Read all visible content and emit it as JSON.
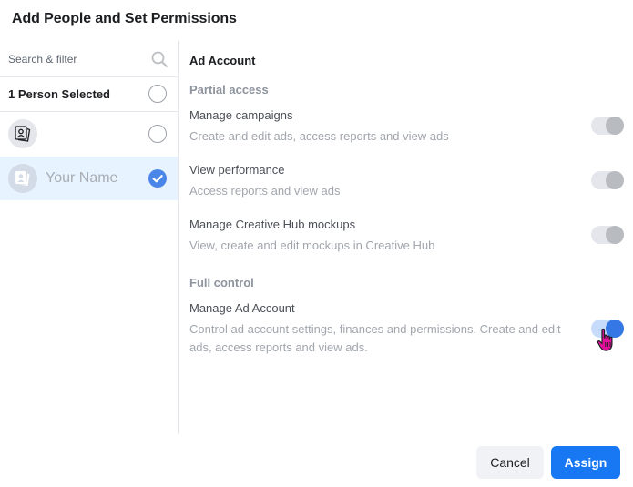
{
  "dialog": {
    "title": "Add People and Set Permissions"
  },
  "people_panel": {
    "search": {
      "placeholder": "Search & filter",
      "value": "",
      "icon": "search-icon"
    },
    "selected_summary": {
      "label": "1 Person Selected",
      "checked": false
    },
    "people": [
      {
        "name": "",
        "avatar_icon": "person-page-icon",
        "checked": false,
        "active": false
      },
      {
        "name": "Your Name",
        "avatar_icon": "person-page-icon",
        "checked": true,
        "active": true
      }
    ]
  },
  "permissions_panel": {
    "section_title": "Ad Account",
    "groups": [
      {
        "label": "Partial access",
        "permissions": [
          {
            "name": "Manage campaigns",
            "description": "Create and edit ads, access reports and view ads",
            "enabled": true,
            "locked": true
          },
          {
            "name": "View performance",
            "description": "Access reports and view ads",
            "enabled": true,
            "locked": true
          },
          {
            "name": "Manage Creative Hub mockups",
            "description": "View, create and edit mockups in Creative Hub",
            "enabled": true,
            "locked": true
          }
        ]
      },
      {
        "label": "Full control",
        "permissions": [
          {
            "name": "Manage Ad Account",
            "description": "Control ad account settings, finances and permissions. Create and edit ads, access reports and view ads.",
            "enabled": true,
            "locked": false
          }
        ]
      }
    ]
  },
  "footer": {
    "cancel_label": "Cancel",
    "assign_label": "Assign"
  },
  "colors": {
    "primary": "#1877f2",
    "toggle_on": "#3578e5",
    "toggle_on_track": "#c7dbfa",
    "toggle_locked_knob": "#b8bbbf",
    "selected_row_bg": "#e7f3ff",
    "check_bg": "#4a86e8",
    "cursor": "#e0109a"
  }
}
